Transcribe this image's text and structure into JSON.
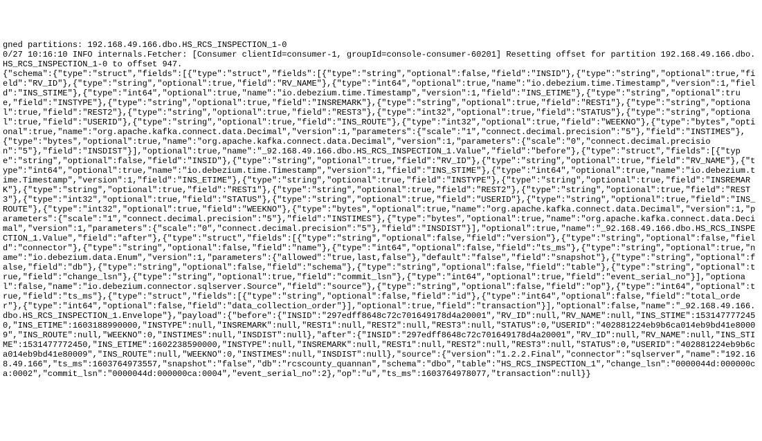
{
  "terminal": {
    "partial_top_line": "gned partitions: 192.168.49.166.dbo.HS_RCS_INSPECTION_1-0",
    "log_line_prefix": "0/27 10:16:10 INFO internals.Fetcher: [Consumer clientId=consumer-1, groupId=console-consumer-60201] Resetting offset for partition 192.168.49.166.dbo.HS_RCS_INSPECTION_1-0 to offset 947.",
    "json_payload": "{\"schema\":{\"type\":\"struct\",\"fields\":[{\"type\":\"struct\",\"fields\":[{\"type\":\"string\",\"optional\":false,\"field\":\"INSID\"},{\"type\":\"string\",\"optional\":true,\"field\":\"RV_ID\"},{\"type\":\"string\",\"optional\":true,\"field\":\"RV_NAME\"},{\"type\":\"int64\",\"optional\":true,\"name\":\"io.debezium.time.Timestamp\",\"version\":1,\"field\":\"INS_STIME\"},{\"type\":\"int64\",\"optional\":true,\"name\":\"io.debezium.time.Timestamp\",\"version\":1,\"field\":\"INS_ETIME\"},{\"type\":\"string\",\"optional\":true,\"field\":\"INSTYPE\"},{\"type\":\"string\",\"optional\":true,\"field\":\"INSREMARK\"},{\"type\":\"string\",\"optional\":true,\"field\":\"REST1\"},{\"type\":\"string\",\"optional\":true,\"field\":\"REST2\"},{\"type\":\"string\",\"optional\":true,\"field\":\"REST3\"},{\"type\":\"int32\",\"optional\":true,\"field\":\"STATUS\"},{\"type\":\"string\",\"optional\":true,\"field\":\"USERID\"},{\"type\":\"string\",\"optional\":true,\"field\":\"INS_ROUTE\"},{\"type\":\"int32\",\"optional\":true,\"field\":\"WEEKNO\"},{\"type\":\"bytes\",\"optional\":true,\"name\":\"org.apache.kafka.connect.data.Decimal\",\"version\":1,\"parameters\":{\"scale\":\"1\",\"connect.decimal.precision\":\"5\"},\"field\":\"INSTIMES\"},{\"type\":\"bytes\",\"optional\":true,\"name\":\"org.apache.kafka.connect.data.Decimal\",\"version\":1,\"parameters\":{\"scale\":\"0\",\"connect.decimal.precision\":\"5\"},\"field\":\"INSDIST\"}],\"optional\":true,\"name\":\"_92.168.49.166.dbo.HS_RCS_INSPECTION_1.Value\",\"field\":\"before\"},{\"type\":\"struct\",\"fields\":[{\"type\":\"string\",\"optional\":false,\"field\":\"INSID\"},{\"type\":\"string\",\"optional\":true,\"field\":\"RV_ID\"},{\"type\":\"string\",\"optional\":true,\"field\":\"RV_NAME\"},{\"type\":\"int64\",\"optional\":true,\"name\":\"io.debezium.time.Timestamp\",\"version\":1,\"field\":\"INS_STIME\"},{\"type\":\"int64\",\"optional\":true,\"name\":\"io.debezium.time.Timestamp\",\"version\":1,\"field\":\"INS_ETIME\"},{\"type\":\"string\",\"optional\":true,\"field\":\"INSTYPE\"},{\"type\":\"string\",\"optional\":true,\"field\":\"INSREMARK\"},{\"type\":\"string\",\"optional\":true,\"field\":\"REST1\"},{\"type\":\"string\",\"optional\":true,\"field\":\"REST2\"},{\"type\":\"string\",\"optional\":true,\"field\":\"REST3\"},{\"type\":\"int32\",\"optional\":true,\"field\":\"STATUS\"},{\"type\":\"string\",\"optional\":true,\"field\":\"USERID\"},{\"type\":\"string\",\"optional\":true,\"field\":\"INS_ROUTE\"},{\"type\":\"int32\",\"optional\":true,\"field\":\"WEEKNO\"},{\"type\":\"bytes\",\"optional\":true,\"name\":\"org.apache.kafka.connect.data.Decimal\",\"version\":1,\"parameters\":{\"scale\":\"1\",\"connect.decimal.precision\":\"5\"},\"field\":\"INSTIMES\"},{\"type\":\"bytes\",\"optional\":true,\"name\":\"org.apache.kafka.connect.data.Decimal\",\"version\":1,\"parameters\":{\"scale\":\"0\",\"connect.decimal.precision\":\"5\"},\"field\":\"INSDIST\"}],\"optional\":true,\"name\":\"_92.168.49.166.dbo.HS_RCS_INSPECTION_1.Value\",\"field\":\"after\"},{\"type\":\"struct\",\"fields\":[{\"type\":\"string\",\"optional\":false,\"field\":\"version\"},{\"type\":\"string\",\"optional\":false,\"field\":\"connector\"},{\"type\":\"string\",\"optional\":false,\"field\":\"name\"},{\"type\":\"int64\",\"optional\":false,\"field\":\"ts_ms\"},{\"type\":\"string\",\"optional\":true,\"name\":\"io.debezium.data.Enum\",\"version\":1,\"parameters\":{\"allowed\":\"true,last,false\"},\"default\":\"false\",\"field\":\"snapshot\"},{\"type\":\"string\",\"optional\":false,\"field\":\"db\"},{\"type\":\"string\",\"optional\":false,\"field\":\"schema\"},{\"type\":\"string\",\"optional\":false,\"field\":\"table\"},{\"type\":\"string\",\"optional\":true,\"field\":\"change_lsn\"},{\"type\":\"string\",\"optional\":true,\"field\":\"commit_lsn\"},{\"type\":\"int64\",\"optional\":true,\"field\":\"event_serial_no\"}],\"optional\":false,\"name\":\"io.debezium.connector.sqlserver.Source\",\"field\":\"source\"},{\"type\":\"string\",\"optional\":false,\"field\":\"op\"},{\"type\":\"int64\",\"optional\":true,\"field\":\"ts_ms\"},{\"type\":\"struct\",\"fields\":[{\"type\":\"string\",\"optional\":false,\"field\":\"id\"},{\"type\":\"int64\",\"optional\":false,\"field\":\"total_order\"},{\"type\":\"int64\",\"optional\":false,\"field\":\"data_collection_order\"}],\"optional\":true,\"field\":\"transaction\"}],\"optional\":false,\"name\":\"_92.168.49.166.dbo.HS_RCS_INSPECTION_1.Envelope\"},\"payload\":{\"before\":{\"INSID\":\"297edff8648c72c701649178d4a20001\",\"RV_ID\":null,\"RV_NAME\":null,\"INS_STIME\":1531477772450,\"INS_ETIME\":1603188990000,\"INSTYPE\":null,\"INSREMARK\":null,\"REST1\":null,\"REST2\":null,\"REST3\":null,\"STATUS\":0,\"USERID\":\"402881224eb9b6ca014eb9bd41e80009\",\"INS_ROUTE\":null,\"WEEKNO\":0,\"INSTIMES\":null,\"INSDIST\":null},\"after\":{\"INSID\":\"297edff8648c72c701649178d4a20001\",\"RV_ID\":null,\"RV_NAME\":null,\"INS_STIME\":1531477772450,\"INS_ETIME\":1602238590000,\"INSTYPE\":null,\"INSREMARK\":null,\"REST1\":null,\"REST2\":null,\"REST3\":null,\"STATUS\":0,\"USERID\":\"402881224eb9b6ca014eb9bd41e80009\",\"INS_ROUTE\":null,\"WEEKNO\":0,\"INSTIMES\":null,\"INSDIST\":null},\"source\":{\"version\":\"1.2.2.Final\",\"connector\":\"sqlserver\",\"name\":\"192.168.49.166\",\"ts_ms\":1603764973557,\"snapshot\":\"false\",\"db\":\"rcscounty_quannan\",\"schema\":\"dbo\",\"table\":\"HS_RCS_INSPECTION_1\",\"change_lsn\":\"0000044d:000000ca:0002\",\"commit_lsn\":\"0000044d:000000ca:0004\",\"event_serial_no\":2},\"op\":\"u\",\"ts_ms\":1603764978077,\"transaction\":null}}"
  }
}
